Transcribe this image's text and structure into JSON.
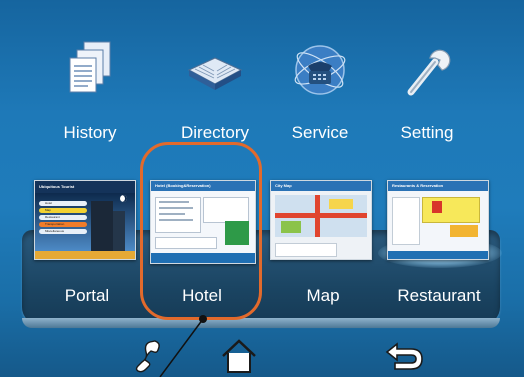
{
  "top_menu": [
    {
      "label": "History",
      "icon": "history-documents-icon"
    },
    {
      "label": "Directory",
      "icon": "directory-book-icon"
    },
    {
      "label": "Service",
      "icon": "service-phone-icon"
    },
    {
      "label": "Setting",
      "icon": "setting-wrench-icon"
    }
  ],
  "cards": [
    {
      "label": "Portal",
      "thumb_title": "Ubiquitous Tourist",
      "menu": [
        "Hotel",
        "Map",
        "Restaurant",
        "Transportation",
        "Miscellaneous"
      ]
    },
    {
      "label": "Hotel",
      "thumb_title": "Hotel (Booking&Reservation)"
    },
    {
      "label": "Map",
      "thumb_title": "City Map"
    },
    {
      "label": "Restaurant",
      "thumb_title": "Restaurants & Reservation"
    }
  ],
  "bottom_bar": [
    {
      "icon": "phone-handset-icon"
    },
    {
      "icon": "home-icon"
    },
    {
      "icon": "back-arrow-icon"
    }
  ],
  "colors": {
    "background": "#1f7cbb",
    "highlight_outline": "#e26a2c",
    "label": "#ffffff"
  }
}
